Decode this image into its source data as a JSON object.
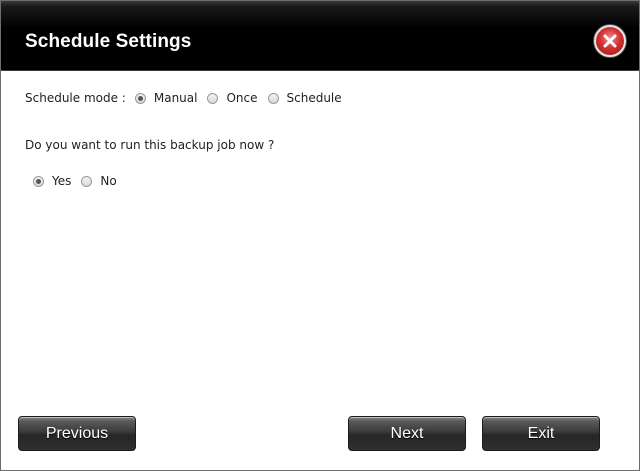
{
  "dialog": {
    "title": "Schedule Settings",
    "close_icon": "close-x-icon"
  },
  "schedule_mode": {
    "label": "Schedule mode :",
    "options": [
      {
        "label": "Manual",
        "selected": true
      },
      {
        "label": "Once",
        "selected": false
      },
      {
        "label": "Schedule",
        "selected": false
      }
    ]
  },
  "run_now": {
    "question": "Do you want to run this backup job now ?",
    "options": [
      {
        "label": "Yes",
        "selected": true
      },
      {
        "label": "No",
        "selected": false
      }
    ]
  },
  "footer": {
    "previous_label": "Previous",
    "next_label": "Next",
    "exit_label": "Exit"
  },
  "colors": {
    "titlebar": "#000000",
    "close_button": "#d33232",
    "button_bg": "#3a3a3a"
  }
}
